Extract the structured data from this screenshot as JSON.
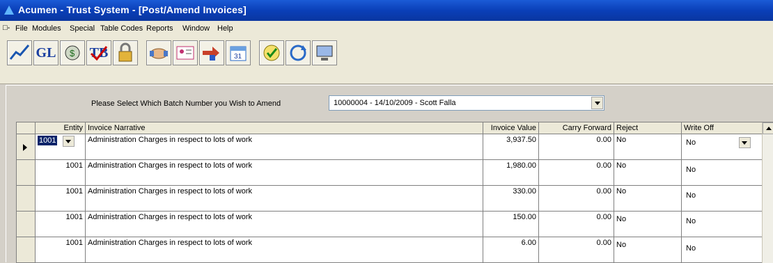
{
  "window": {
    "title": "Acumen - Trust System - [Post/Amend Invoices]"
  },
  "menu": {
    "items": [
      "File",
      "Modules",
      "Special",
      "Table Codes",
      "Reports",
      "Window",
      "Help"
    ]
  },
  "toolbar": {
    "buttons": [
      {
        "icon": "chart-trend-icon"
      },
      {
        "label": "GL",
        "icon": "general-ledger-icon"
      },
      {
        "icon": "money-bag-icon"
      },
      {
        "label": "TB",
        "icon": "trial-balance-icon"
      },
      {
        "icon": "lock-icon"
      },
      {
        "icon": "handshake-icon"
      },
      {
        "icon": "contact-card-icon"
      },
      {
        "icon": "transfer-arrows-icon"
      },
      {
        "icon": "calendar-icon"
      },
      {
        "icon": "checklist-icon"
      },
      {
        "icon": "refresh-icon"
      },
      {
        "icon": "computer-icon"
      }
    ]
  },
  "batch": {
    "label": "Please Select Which Batch Number you Wish to Amend",
    "selected": "10000004 - 14/10/2009 - Scott Falla"
  },
  "grid": {
    "columns": [
      "Entity",
      "Invoice Narrative",
      "Invoice Value",
      "Carry Forward",
      "Reject",
      "Write Off"
    ],
    "rows": [
      {
        "entity": "1001",
        "narrative": "Administration Charges in respect to lots of work",
        "value": "3,937.50",
        "carry": "0.00",
        "reject": "No",
        "writeoff": "No"
      },
      {
        "entity": "1001",
        "narrative": "Administration Charges in respect to lots of work",
        "value": "1,980.00",
        "carry": "0.00",
        "reject": "No",
        "writeoff": "No"
      },
      {
        "entity": "1001",
        "narrative": "Administration Charges in respect to lots of work",
        "value": "330.00",
        "carry": "0.00",
        "reject": "No",
        "writeoff": "No"
      },
      {
        "entity": "1001",
        "narrative": "Administration Charges in respect to lots of work",
        "value": "150.00",
        "carry": "0.00",
        "reject": "No",
        "writeoff": "No"
      },
      {
        "entity": "1001",
        "narrative": "Administration Charges in respect to lots of work",
        "value": "6.00",
        "carry": "0.00",
        "reject": "No",
        "writeoff": "No"
      }
    ]
  }
}
